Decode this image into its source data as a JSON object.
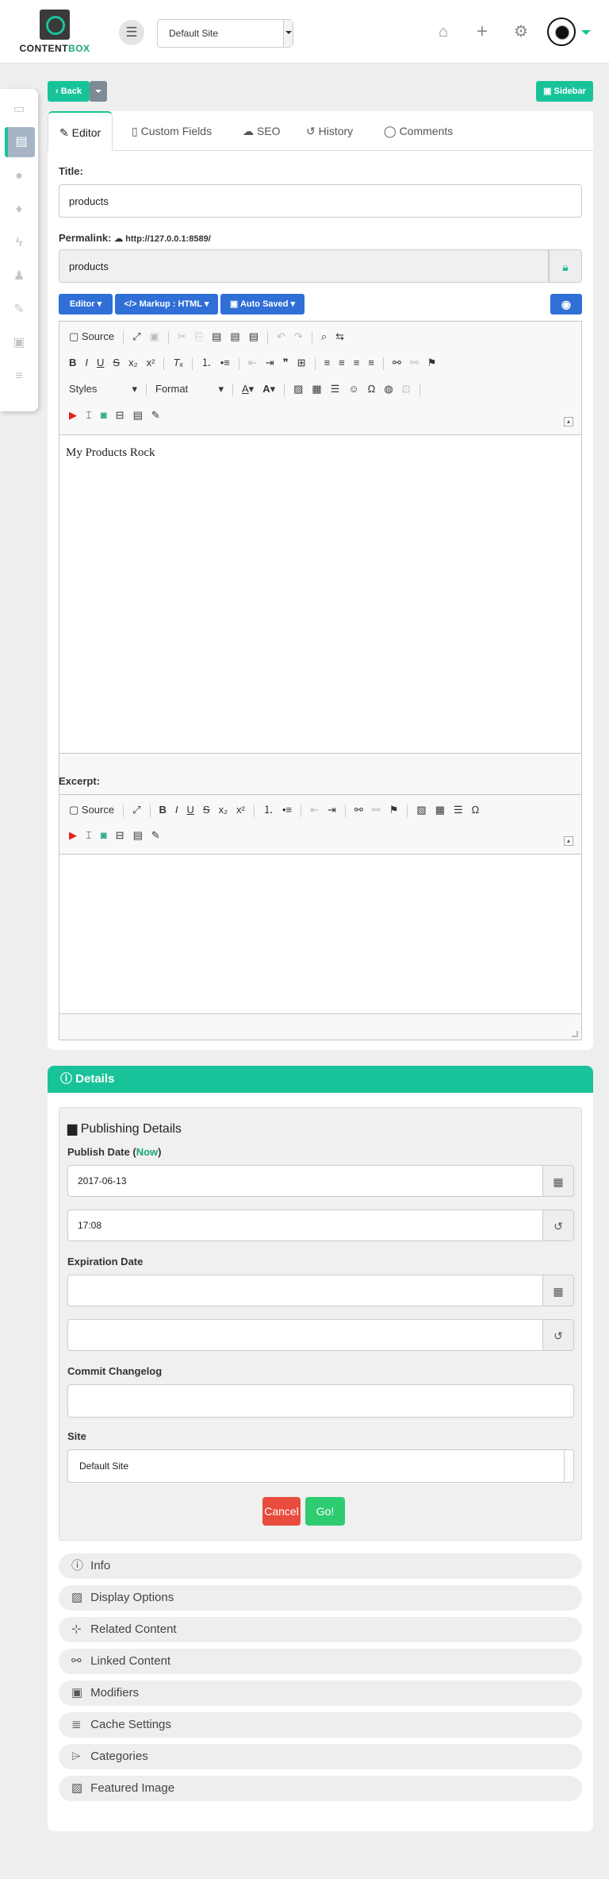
{
  "brand": {
    "part1": "CONTENT",
    "part2": "BOX"
  },
  "header": {
    "site_select": "Default Site"
  },
  "buttons": {
    "back": "Back",
    "sidebar": "Sidebar"
  },
  "tabs": [
    "Editor",
    "Custom Fields",
    "SEO",
    "History",
    "Comments"
  ],
  "form": {
    "title_label": "Title:",
    "title_value": "products",
    "permalink_label": "Permalink:",
    "permalink_url": "http://127.0.0.1:8589/",
    "permalink_value": "products"
  },
  "editor_buttons": {
    "editor": "Editor",
    "markup": "Markup : HTML",
    "autosave": "Auto Saved"
  },
  "toolbar": {
    "source": "Source",
    "styles": "Styles",
    "format": "Format"
  },
  "content_text": "My Products Rock",
  "excerpt_label": "Excerpt:",
  "details": {
    "header": "Details",
    "publishing_title": "Publishing Details",
    "publish_date_label": "Publish Date (",
    "now_link": "Now",
    "publish_date_close": ")",
    "publish_date": "2017-06-13",
    "publish_time": "17:08",
    "expiration_label": "Expiration Date",
    "expiration_date": "",
    "expiration_time": "",
    "changelog_label": "Commit Changelog",
    "changelog_value": "",
    "site_label": "Site",
    "site_value": "Default Site",
    "cancel": "Cancel",
    "go": "Go!"
  },
  "accordions": [
    "Info",
    "Display Options",
    "Related Content",
    "Linked Content",
    "Modifiers",
    "Cache Settings",
    "Categories",
    "Featured Image"
  ],
  "colors": {
    "accent": "#19c39a",
    "blue": "#2f6fd6",
    "cancel": "#e74c3c",
    "go": "#2ecc71"
  }
}
